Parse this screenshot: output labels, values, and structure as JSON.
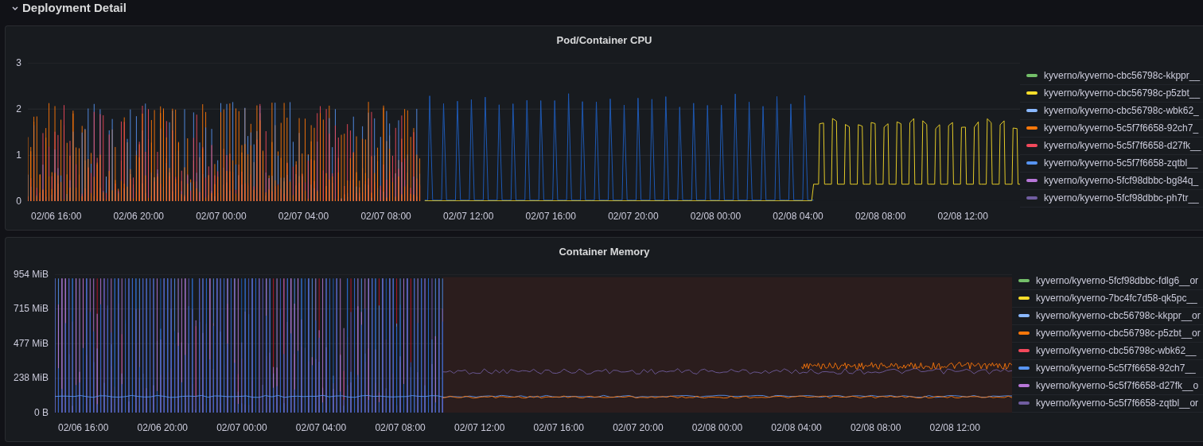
{
  "section": {
    "title": "Deployment Detail",
    "expanded": true
  },
  "panels": [
    {
      "kind": "cpu",
      "title": "Pod/Container CPU",
      "yticks": [
        "3",
        "2",
        "1",
        "0"
      ],
      "xticks": [
        "02/06 16:00",
        "02/06 20:00",
        "02/07 00:00",
        "02/07 04:00",
        "02/07 08:00",
        "02/07 12:00",
        "02/07 16:00",
        "02/07 20:00",
        "02/08 00:00",
        "02/08 04:00",
        "02/08 08:00",
        "02/08 12:00"
      ],
      "legend": [
        {
          "label": "kyverno/kyverno-cbc56798c-kkppr__",
          "color": "#73bf69"
        },
        {
          "label": "kyverno/kyverno-cbc56798c-p5zbt__",
          "color": "#fade2a"
        },
        {
          "label": "kyverno/kyverno-cbc56798c-wbk62_",
          "color": "#8ab8ff"
        },
        {
          "label": "kyverno/kyverno-5c5f7f6658-92ch7_",
          "color": "#ff780a"
        },
        {
          "label": "kyverno/kyverno-5c5f7f6658-d27fk__",
          "color": "#f2495c"
        },
        {
          "label": "kyverno/kyverno-5c5f7f6658-zqtbl__",
          "color": "#5794f2"
        },
        {
          "label": "kyverno/kyverno-5fcf98dbbc-bg84q_",
          "color": "#b877d9"
        },
        {
          "label": "kyverno/kyverno-5fcf98dbbc-ph7tr__",
          "color": "#705da0"
        }
      ]
    },
    {
      "kind": "memory",
      "title": "Container Memory",
      "yticks": [
        "954 MiB",
        "715 MiB",
        "477 MiB",
        "238 MiB",
        "0 B"
      ],
      "xticks": [
        "02/06 16:00",
        "02/06 20:00",
        "02/07 00:00",
        "02/07 04:00",
        "02/07 08:00",
        "02/07 12:00",
        "02/07 16:00",
        "02/07 20:00",
        "02/08 00:00",
        "02/08 04:00",
        "02/08 08:00",
        "02/08 12:00"
      ],
      "legend": [
        {
          "label": "kyverno/kyverno-5fcf98dbbc-fdlg6__or",
          "color": "#73bf69"
        },
        {
          "label": "kyverno/kyverno-7bc4fc7d58-qk5pc__",
          "color": "#fade2a"
        },
        {
          "label": "kyverno/kyverno-cbc56798c-kkppr__or",
          "color": "#8ab8ff"
        },
        {
          "label": "kyverno/kyverno-cbc56798c-p5zbt__or",
          "color": "#ff780a"
        },
        {
          "label": "kyverno/kyverno-cbc56798c-wbk62__",
          "color": "#f2495c"
        },
        {
          "label": "kyverno/kyverno-5c5f7f6658-92ch7__",
          "color": "#5794f2"
        },
        {
          "label": "kyverno/kyverno-5c5f7f6658-d27fk__o",
          "color": "#b877d9"
        },
        {
          "label": "kyverno/kyverno-5c5f7f6658-zqtbl__or",
          "color": "#705da0"
        }
      ]
    }
  ]
}
